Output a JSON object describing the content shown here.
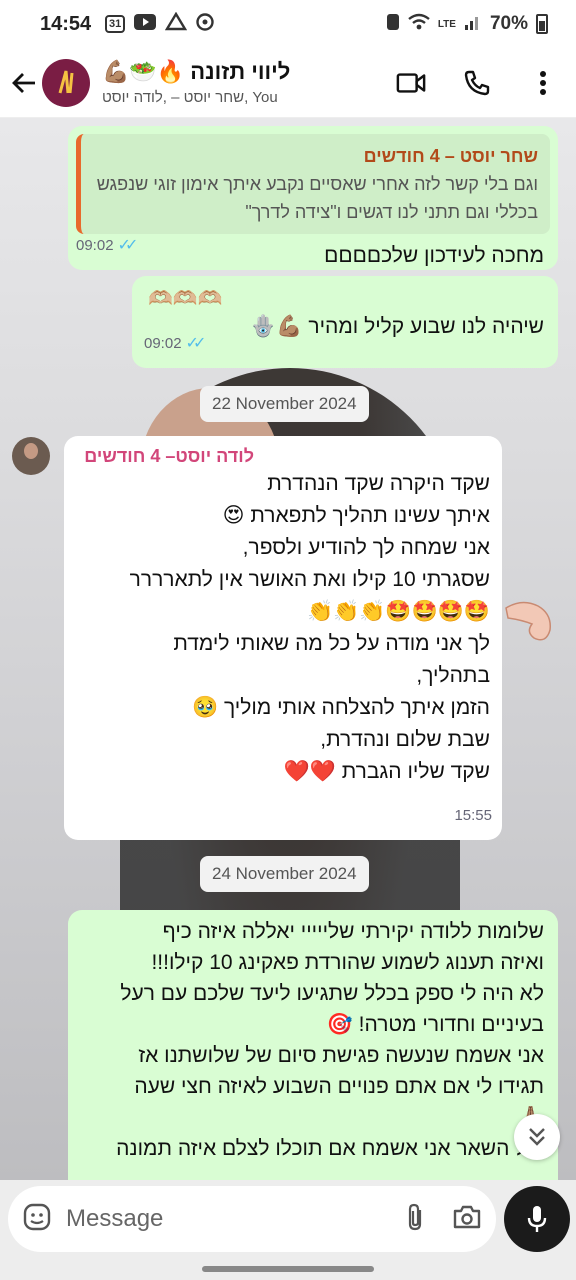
{
  "status_bar": {
    "time": "14:54",
    "left_icons": [
      "31",
      "youtube-icon",
      "drive-icon",
      "sync-icon"
    ],
    "network": "LTE",
    "battery": "70%"
  },
  "header": {
    "title": "ליווי תזונה 🔥🥗💪🏽",
    "subtitle": "שחר יוסט – ,לודה יוסט, You",
    "back_icon": "arrow-left-icon",
    "video_icon": "video-call-icon",
    "call_icon": "phone-icon",
    "menu_icon": "more-vert-icon"
  },
  "messages": [
    {
      "kind": "outgoing",
      "quote_author": "שחר יוסט – 4 חודשים",
      "quote_text": "וגם בלי קשר לזה אחרי שאסיים נקבע איתך אימון זוגי שנפגש בכללי וגם תתני לנו דגשים ו\"צידה לדרך\"",
      "text": "מחכה לעידכון שלכםםםם",
      "time": "09:02"
    },
    {
      "kind": "outgoing",
      "emoji_line": "🫶🏼🫶🏼🫶🏼",
      "text": "שיהיה לנו שבוע קליל ומהיר 💪🏽🪬",
      "time": "09:02"
    },
    {
      "kind": "date",
      "text": "22 November 2024"
    },
    {
      "kind": "incoming",
      "sender": "לודה יוסט– 4 חודשים",
      "lines": [
        "שקד היקרה שקד הנהדרת",
        "איתך עשינו תהליך לתפארת 😍",
        "אני שמחה לך להודיע ולספר,",
        "שסגרתי 10 קילו ואת האושר אין לתארררר",
        "👏👏👏🤩🤩🤩🤩",
        "לך אני מודה על כל מה שאותי לימדת",
        "בתהליך,",
        "הזמן איתך להצלחה אותי מוליך 🥹",
        "שבת שלום ונהדרת,",
        "שקד שליו הגברת ❤️❤️"
      ],
      "time": "15:55"
    },
    {
      "kind": "date",
      "text": "24 November 2024"
    },
    {
      "kind": "outgoing",
      "lines": [
        "שלומות ללודה יקירתי שלייייי יאללה איזה כיף",
        "ואיזה תענוג לשמוע שהורדת פאקינג 10 קילו!!!",
        "לא היה לי ספק בכלל שתגיעו ליעד שלכם עם רעל",
        "בעיניים וחדורי מטרה! 🎯",
        "אני אשמח שנעשה פגישת סיום של שלושתנו אז",
        "תגידו לי אם אתם פנויים השבוע לאיזה חצי שעה",
        "🙏🏽",
        "ובל השאר אני אשמח אם תוכלו לצלם איזה תמונה"
      ]
    }
  ],
  "composer": {
    "placeholder": "Message",
    "emoji_icon": "sticker-icon",
    "attach_icon": "paperclip-icon",
    "camera_icon": "camera-icon",
    "mic_icon": "microphone-icon"
  },
  "colors": {
    "outgoing_bubble": "#d9fdd3",
    "incoming_bubble": "#ffffff",
    "read_ticks": "#53bdeb",
    "sender_name": "#d2467a",
    "quote_bar": "#e86a2c"
  }
}
